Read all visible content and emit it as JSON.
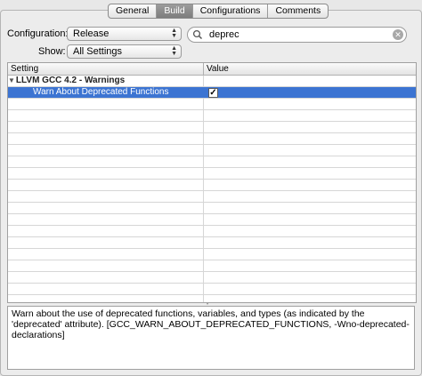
{
  "tabs": [
    "General",
    "Build",
    "Configurations",
    "Comments"
  ],
  "active_tab": "Build",
  "configuration": {
    "label": "Configuration:",
    "value": "Release"
  },
  "show": {
    "label": "Show:",
    "value": "All Settings"
  },
  "search": {
    "value": "deprec"
  },
  "table": {
    "headers": [
      "Setting",
      "Value"
    ],
    "group": "LLVM GCC 4.2 - Warnings",
    "rows": [
      {
        "setting": "Warn About Deprecated Functions",
        "checked": true
      }
    ]
  },
  "description": "Warn about the use of deprecated functions, variables, and types (as indicated by the 'deprecated' attribute).  [GCC_WARN_ABOUT_DEPRECATED_FUNCTIONS, -Wno-deprecated-declarations]"
}
